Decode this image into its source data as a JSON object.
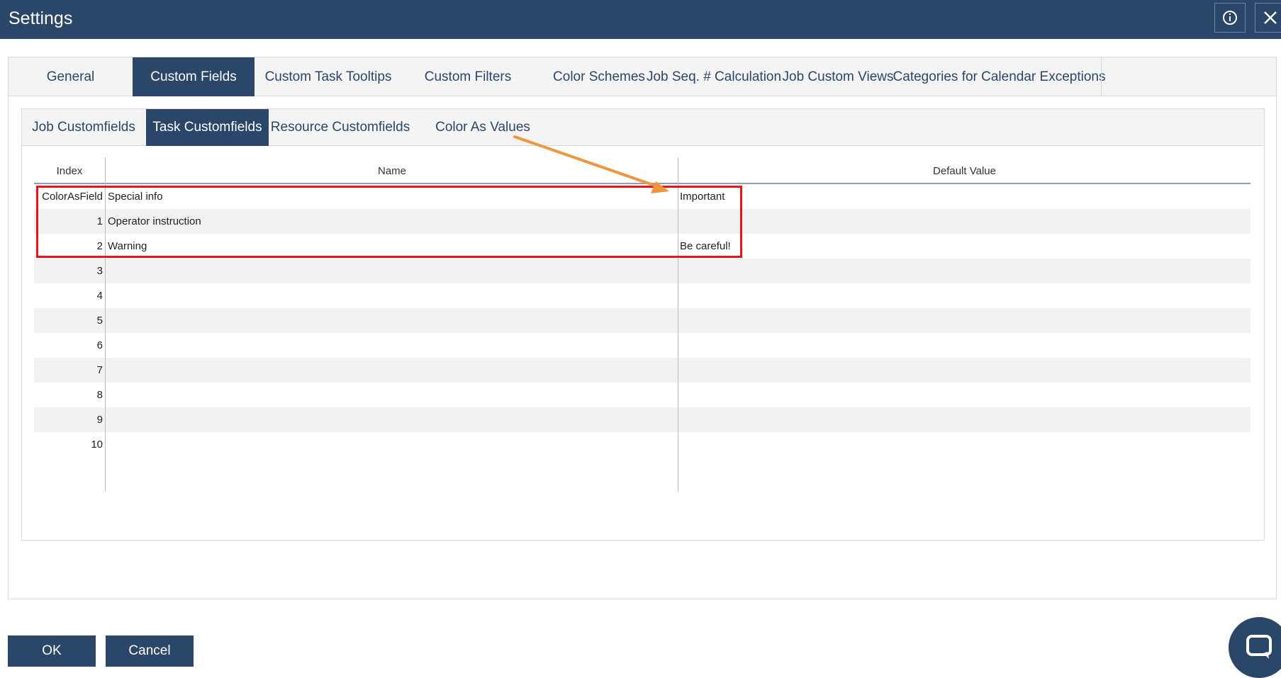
{
  "window": {
    "title": "Settings"
  },
  "icons": {
    "info": "info-circle-icon",
    "close": "close-icon",
    "chat": "chat-bubble-icon"
  },
  "main_tabs": [
    {
      "label": "General",
      "active": false
    },
    {
      "label": "Custom Fields",
      "active": true
    },
    {
      "label": "Custom Task Tooltips",
      "active": false
    },
    {
      "label": "Custom Filters",
      "active": false
    },
    {
      "label": "Color Schemes",
      "active": false
    },
    {
      "label": "Job Seq. # Calculation",
      "active": false
    },
    {
      "label": "Job Custom Views",
      "active": false
    },
    {
      "label": "Categories for Calendar Exceptions",
      "active": false
    }
  ],
  "sub_tabs": [
    {
      "label": "Job Customfields",
      "active": false
    },
    {
      "label": "Task Customfields",
      "active": true
    },
    {
      "label": "Resource Customfields",
      "active": false
    },
    {
      "label": "Color As Values",
      "active": false
    }
  ],
  "grid": {
    "columns": {
      "index": "Index",
      "name": "Name",
      "default": "Default Value"
    },
    "rows": [
      {
        "index": "ColorAsField",
        "name": "Special info",
        "default": "Important"
      },
      {
        "index": "1",
        "name": "Operator instruction",
        "default": ""
      },
      {
        "index": "2",
        "name": "Warning",
        "default": "Be careful!"
      },
      {
        "index": "3",
        "name": "",
        "default": ""
      },
      {
        "index": "4",
        "name": "",
        "default": ""
      },
      {
        "index": "5",
        "name": "",
        "default": ""
      },
      {
        "index": "6",
        "name": "",
        "default": ""
      },
      {
        "index": "7",
        "name": "",
        "default": ""
      },
      {
        "index": "8",
        "name": "",
        "default": ""
      },
      {
        "index": "9",
        "name": "",
        "default": ""
      },
      {
        "index": "10",
        "name": "",
        "default": ""
      }
    ]
  },
  "footer": {
    "ok": "OK",
    "cancel": "Cancel"
  },
  "colors": {
    "primary": "#2a4669",
    "highlight": "#e8141c",
    "arrow": "#f0963c"
  }
}
